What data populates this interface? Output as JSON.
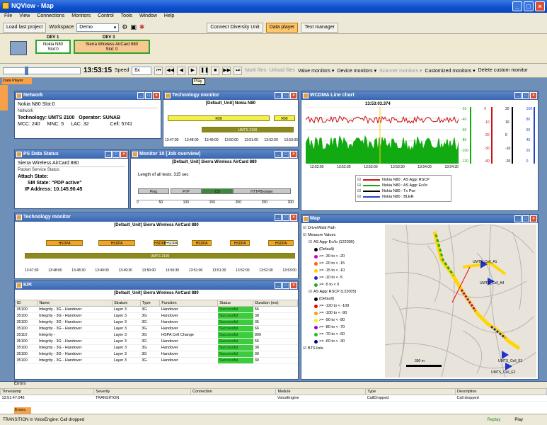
{
  "app": {
    "title": "NQView - Map"
  },
  "menu": [
    "File",
    "View",
    "Connections",
    "Monitors",
    "Control",
    "Tools",
    "Window",
    "Help"
  ],
  "toolbar": {
    "load_label": "Load last project",
    "workspace_label": "Workspace",
    "workspace_value": "Demo",
    "diversity_label": "Connect Diversity Unit",
    "data_player_label": "Data player",
    "text_manager_label": "Text manager"
  },
  "devices": [
    {
      "header": "DEV 1",
      "line1": "Nokia N80",
      "line2": "Slot:0"
    },
    {
      "header": "DEV 3",
      "line1": "Sierra Wireless AirCard 880",
      "line2": "Slot: 0"
    }
  ],
  "player": {
    "time": "13:53:15",
    "speed_label": "Speed",
    "speed_value": "6x",
    "tooltip": "Play",
    "tab_label": "Data Player",
    "menu": [
      "Mark files",
      "Unload files",
      "Value monitors ▾",
      "Device monitors ▾",
      "Scanner monitors ▾",
      "Customized monitors ▾",
      "Delete custom monitor"
    ]
  },
  "network": {
    "title": "Network",
    "device": "Nokia N80 Slot:0",
    "group": "Network",
    "technology_label": "Technology:",
    "technology": "UMTS 2100",
    "operator_label": "Operator:",
    "operator": "SUNAB",
    "mcc": "MCC: 240",
    "mnc": "MNC: 5",
    "lac": "LAC: 32",
    "cell": "Cell: 5741"
  },
  "tech1": {
    "title": "Technology monitor",
    "header": "[Default_Unit] Nokia N80",
    "bar1": "R99",
    "bar1b": "R99",
    "bar2": "UMTS 2100",
    "ticks": [
      "13:47:00",
      "13:48:00",
      "13:49:00",
      "13:50:00",
      "13:51:00",
      "13:52:00",
      "13:53:00"
    ]
  },
  "wcdma": {
    "title": "WCDMA Line chart",
    "time": "13:53:03.374",
    "legend": [
      "Nokia N80 : AS Aggr RSCP",
      "Nokia N80 : AS Aggr Ec/Io",
      "Nokia N80 : Tx Pwr",
      "Nokia N80 : BLER"
    ],
    "xticks": [
      "13:52:00",
      "13:52:30",
      "13:53:00",
      "13:53:30",
      "13:54:00",
      "13:54:30"
    ],
    "axis1": [
      "-20",
      "-40",
      "-60",
      "-80",
      "-100",
      "-120"
    ],
    "axis2": [
      "0",
      "-10",
      "-20",
      "-30",
      "-40"
    ],
    "axis3": [
      "20",
      "10",
      "0",
      "-10",
      "-20"
    ],
    "axis4": [
      "100",
      "80",
      "60",
      "40",
      "20",
      "0"
    ],
    "colors": {
      "rscp": "#cc1111",
      "ecio": "#11aa11"
    }
  },
  "ps": {
    "title": "PS Data Status",
    "device": "Sierra Wireless AirCard 880",
    "group": "Packet Service Status",
    "attach_label": "Attach State:",
    "sm_label": "SM State:",
    "sm_value": "\"PDP active\"",
    "ip_label": "IP Address:",
    "ip_value": "10.145.90.45"
  },
  "monitor10": {
    "title": "Monitor 10 [Job overview]",
    "header": "[Default_Unit] Sierra Wireless AirCard 880",
    "length": "Length of all tests:",
    "length_value": "315 sec",
    "jobs": [
      "Ping",
      "FTP",
      "CS",
      "HTTPBrowser"
    ],
    "ticks": [
      "0",
      "50",
      "100",
      "150",
      "200",
      "250",
      "300"
    ]
  },
  "tech2": {
    "title": "Technology monitor",
    "header": "[Default_Unit] Sierra Wireless AirCard 880",
    "hsdpa": [
      "HSDPA",
      "HSDPA",
      "HSDPA",
      "HSDPA",
      "HSDPA",
      "HSDPA",
      "HSDPA"
    ],
    "hsdpa_overlap": "HSDPA",
    "umts": "UMTS 2100",
    "ticks": [
      "13:47:30",
      "13:48:00",
      "13:48:30",
      "13:49:00",
      "13:49:30",
      "13:50:00",
      "13:50:30",
      "13:51:00",
      "13:51:30",
      "13:52:00",
      "13:52:30",
      "13:53:00"
    ]
  },
  "map": {
    "title": "Map",
    "tree": [
      {
        "label": "Drive/Walk Path",
        "indent": 0
      },
      {
        "label": "Measure Values",
        "indent": 0
      },
      {
        "label": "AS Aggr Ec/Io (122005)",
        "indent": 1
      },
      {
        "label": "(Default)",
        "indent": 2,
        "color": "#000"
      },
      {
        "label": ">= -30 to < -20",
        "indent": 2,
        "color": "#cc00cc"
      },
      {
        "label": ">= -20 to < -15",
        "indent": 2,
        "color": "#ff6600"
      },
      {
        "label": ">= -15 to < -10",
        "indent": 2,
        "color": "#ffcc00"
      },
      {
        "label": ">= -10 to < -5",
        "indent": 2,
        "color": "#2222cc"
      },
      {
        "label": ">= -5 to < 0",
        "indent": 2,
        "color": "#22aa22"
      },
      {
        "label": "AS Aggr RSCP (122005)",
        "indent": 1
      },
      {
        "label": "(Default)",
        "indent": 2,
        "color": "#000"
      },
      {
        "label": ">= -120 to < -100",
        "indent": 2,
        "color": "#ee0000"
      },
      {
        "label": ">= -100 to < -90",
        "indent": 2,
        "color": "#ff9900"
      },
      {
        "label": ">= -90 to < -80",
        "indent": 2,
        "color": "#ffee00"
      },
      {
        "label": ">= -80 to < -70",
        "indent": 2,
        "color": "#9900cc"
      },
      {
        "label": ">= -70 to < -60",
        "indent": 2,
        "color": "#22bb22"
      },
      {
        "label": ">= -60 to < -30",
        "indent": 2,
        "color": "#000088"
      },
      {
        "label": "BTS lists",
        "indent": 0
      }
    ],
    "cells": [
      "UMTS_Cell_A1",
      "UMTS_Cell_A4",
      "UMTS_Cell_E1",
      "UMTS_Cell_E2"
    ],
    "scale": "300 m"
  },
  "kpi": {
    "title": "KPI",
    "header": "[Default_Unit] Sierra Wireless AirCard 880",
    "columns": [
      "ID",
      "Name",
      "Stratum",
      "Type",
      "Function",
      "Status",
      "Duration (ms)"
    ],
    "rows": [
      [
        "35100",
        "Integrity - 3G - Handover",
        "Layer 3",
        "3G",
        "Handover",
        "Successful",
        "55"
      ],
      [
        "35100",
        "Integrity - 3G - Handover",
        "Layer 3",
        "3G",
        "Handover",
        "Successful",
        "38"
      ],
      [
        "35100",
        "Integrity - 3G - Handover",
        "Layer 3",
        "3G",
        "Handover",
        "Successful",
        "35"
      ],
      [
        "35100",
        "Integrity - 3G - Handover",
        "Layer 3",
        "3G",
        "Handover",
        "Successful",
        "66"
      ],
      [
        "35110",
        "Integrity -",
        "Layer 3",
        "3G",
        "HSPA Cell Change",
        "Successful",
        "899"
      ],
      [
        "35100",
        "Integrity - 3G - Handover",
        "Layer 3",
        "3G",
        "Handover",
        "Successful",
        "55"
      ],
      [
        "35100",
        "Integrity - 3G - Handover",
        "Layer 3",
        "3G",
        "Handover",
        "Successful",
        "38"
      ],
      [
        "35100",
        "Integrity - 3G - Handover",
        "Layer 3",
        "3G",
        "Handover",
        "Successful",
        "30"
      ],
      [
        "35100",
        "Integrity - 3G - Handover",
        "Layer 3",
        "3G",
        "Handover",
        "Successful",
        "30"
      ]
    ]
  },
  "errors": {
    "title": "Errors",
    "columns": [
      "Timestamp",
      "Severity",
      "Connection",
      "Module",
      "Type",
      "Description"
    ],
    "row": [
      "13:51:47.046",
      "TRANSITION",
      "",
      "VoiceEngine",
      "CallDropped",
      "Call dropped"
    ],
    "tab": "Errors"
  },
  "status": {
    "text": "TRANSITION in VoiceEngine: Call dropped",
    "replay": "Replay",
    "play": "Play"
  }
}
